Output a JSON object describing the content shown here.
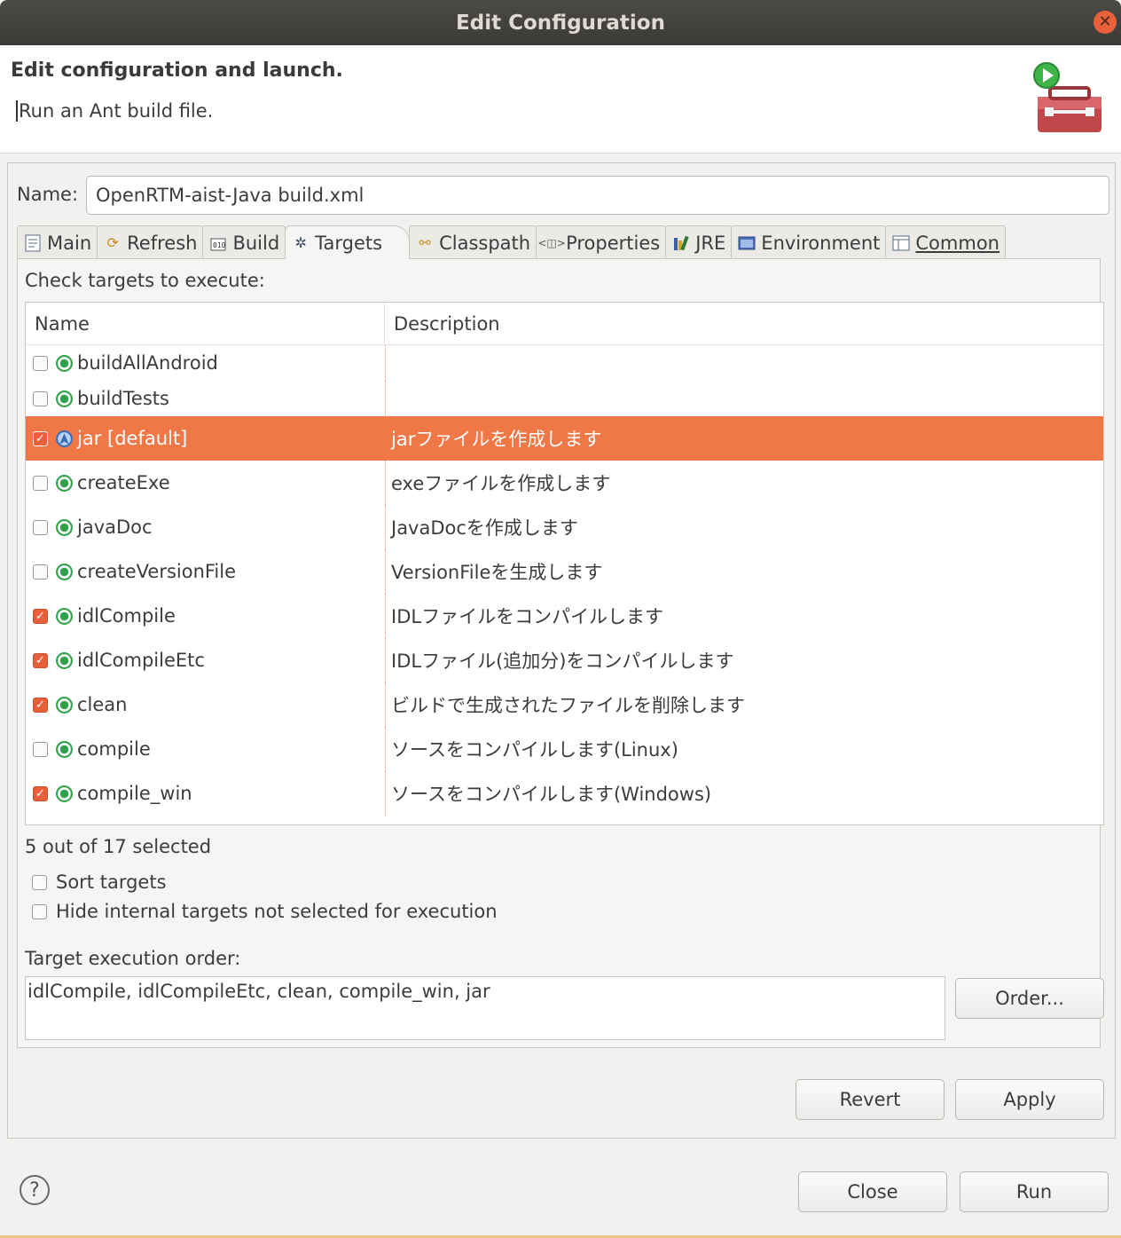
{
  "window": {
    "title": "Edit Configuration"
  },
  "header": {
    "title": "Edit configuration and launch.",
    "description": "Run an Ant build file."
  },
  "config": {
    "name_label": "Name:",
    "name_value": "OpenRTM-aist-Java build.xml"
  },
  "tabs": [
    {
      "label": "Main",
      "icon": "main-icon"
    },
    {
      "label": "Refresh",
      "icon": "refresh-icon"
    },
    {
      "label": "Build",
      "icon": "build-icon"
    },
    {
      "label": "Targets",
      "icon": "targets-icon",
      "active": true
    },
    {
      "label": "Classpath",
      "icon": "classpath-icon"
    },
    {
      "label": "Properties",
      "icon": "properties-icon"
    },
    {
      "label": "JRE",
      "icon": "jre-icon"
    },
    {
      "label": "Environment",
      "icon": "environment-icon"
    },
    {
      "label": "Common",
      "icon": "common-icon"
    }
  ],
  "targets": {
    "instruction": "Check targets to execute:",
    "columns": {
      "name": "Name",
      "description": "Description"
    },
    "rows": [
      {
        "name": "buildAllAndroid",
        "description": "",
        "checked": false
      },
      {
        "name": "buildTests",
        "description": "",
        "checked": false
      },
      {
        "name": "jar [default]",
        "description": "jarファイルを作成します",
        "checked": true
      },
      {
        "name": "createExe",
        "description": "exeファイルを作成します",
        "checked": false
      },
      {
        "name": "javaDoc",
        "description": "JavaDocを作成します",
        "checked": false
      },
      {
        "name": "createVersionFile",
        "description": "VersionFileを生成します",
        "checked": false
      },
      {
        "name": "idlCompile",
        "description": "IDLファイルをコンパイルします",
        "checked": true
      },
      {
        "name": "idlCompileEtc",
        "description": "IDLファイル(追加分)をコンパイルします",
        "checked": true
      },
      {
        "name": "clean",
        "description": "ビルドで生成されたファイルを削除します",
        "checked": true
      },
      {
        "name": "compile",
        "description": "ソースをコンパイルします(Linux)",
        "checked": false
      },
      {
        "name": "compile_win",
        "description": "ソースをコンパイルします(Windows)",
        "checked": true
      }
    ],
    "selection_count": "5 out of 17 selected",
    "sort_label": "Sort targets",
    "hide_label": "Hide internal targets not selected for execution",
    "order_label": "Target execution order:",
    "order_value": "idlCompile, idlCompileEtc, clean, compile_win, jar",
    "order_button": "Order..."
  },
  "buttons": {
    "revert": "Revert",
    "apply": "Apply",
    "close": "Close",
    "run": "Run"
  },
  "colors": {
    "selection": "#f07746",
    "accent": "#e8603a",
    "target_icon": "#2fa24a"
  }
}
